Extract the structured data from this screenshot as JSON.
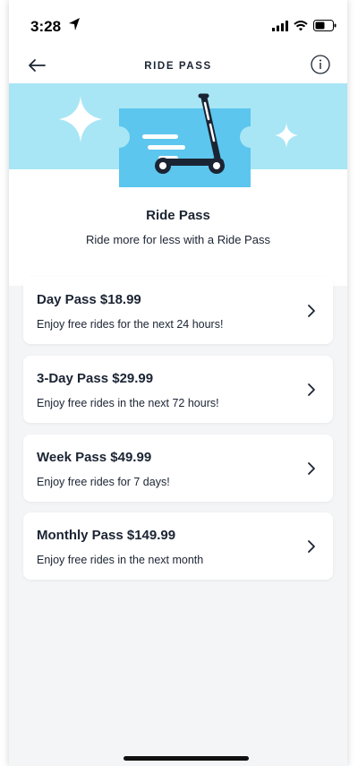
{
  "status_bar": {
    "time": "3:28"
  },
  "nav": {
    "title": "RIDE PASS"
  },
  "hero": {
    "title": "Ride Pass",
    "subtitle": "Ride more for less with a Ride Pass"
  },
  "passes": [
    {
      "title": "Day Pass $18.99",
      "description": "Enjoy free rides for the next 24 hours!"
    },
    {
      "title": "3-Day Pass $29.99",
      "description": "Enjoy free rides in the next 72 hours!"
    },
    {
      "title": "Week Pass $49.99",
      "description": "Enjoy free rides for 7 days!"
    },
    {
      "title": "Monthly Pass $149.99",
      "description": "Enjoy free rides in the next month"
    }
  ],
  "colors": {
    "hero_background": "#a8e6f5",
    "ticket": "#5cc6ee",
    "text": "#1b2433",
    "page_background": "#f4f5f7"
  },
  "icons": [
    "location-arrow-icon",
    "signal-icon",
    "wifi-icon",
    "battery-icon",
    "back-arrow-icon",
    "info-icon",
    "scooter-ticket-illustration",
    "sparkle-icon",
    "chevron-right-icon"
  ]
}
